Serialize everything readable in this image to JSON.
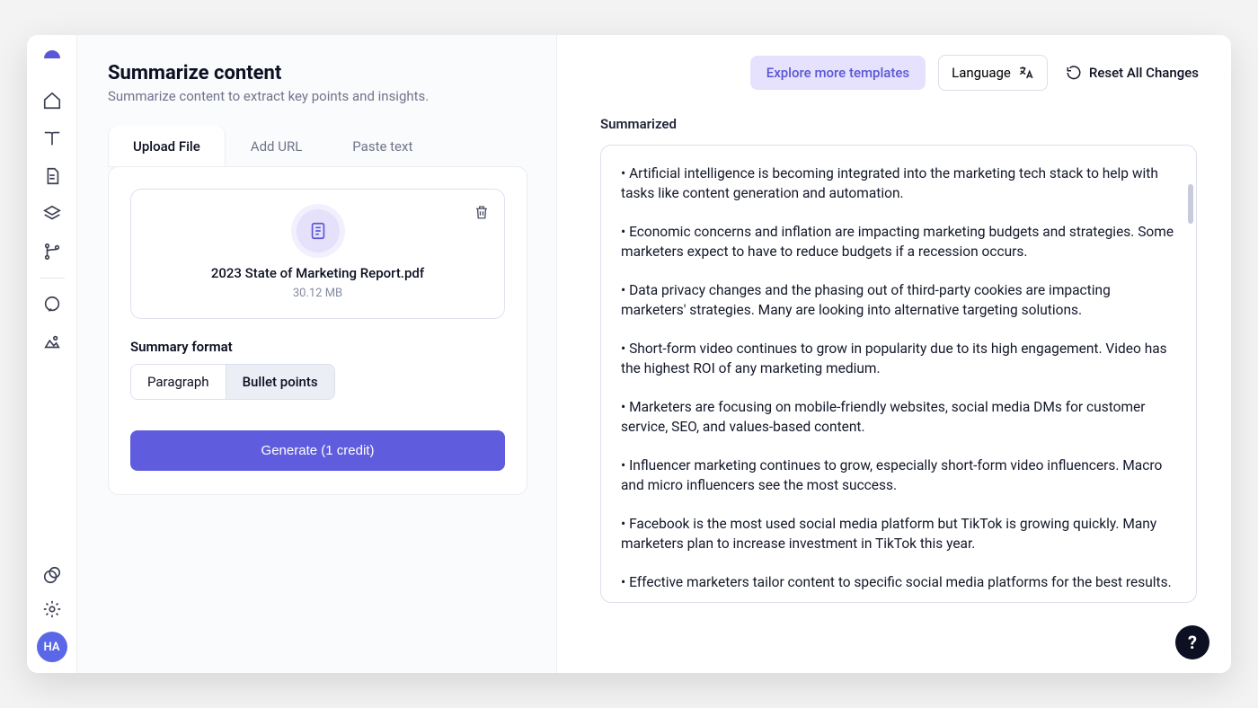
{
  "sidebar": {
    "avatar_initials": "HA"
  },
  "header": {
    "title": "Summarize content",
    "subtitle": "Summarize content to extract key points and insights."
  },
  "tabs": [
    {
      "label": "Upload File",
      "active": true
    },
    {
      "label": "Add URL",
      "active": false
    },
    {
      "label": "Paste text",
      "active": false
    }
  ],
  "uploaded_file": {
    "name": "2023 State of Marketing Report.pdf",
    "size": "30.12 MB"
  },
  "format": {
    "label": "Summary format",
    "options": [
      "Paragraph",
      "Bullet points"
    ],
    "selected": "Bullet points"
  },
  "generate_label": "Generate (1 credit)",
  "right_actions": {
    "explore": "Explore more templates",
    "language": "Language",
    "reset": "Reset All Changes"
  },
  "output": {
    "title": "Summarized",
    "points": [
      "Artificial intelligence is becoming integrated into the marketing tech stack to help with tasks like content generation and automation.",
      "Economic concerns and inflation are impacting marketing budgets and strategies. Some marketers expect to have to reduce budgets if a recession occurs.",
      "Data privacy changes and the phasing out of third-party cookies are impacting marketers' strategies. Many are looking into alternative targeting solutions.",
      "Short-form video continues to grow in popularity due to its high engagement. Video has the highest ROI of any marketing medium.",
      "Marketers are focusing on mobile-friendly websites, social media DMs for customer service, SEO, and values-based content.",
      "Influencer marketing continues to grow, especially short-form video influencers. Macro and micro influencers see the most success.",
      "Facebook is the most used social media platform but TikTok is growing quickly. Many marketers plan to increase investment in TikTok this year.",
      "Effective marketers tailor content to specific social media platforms for the best results."
    ]
  }
}
